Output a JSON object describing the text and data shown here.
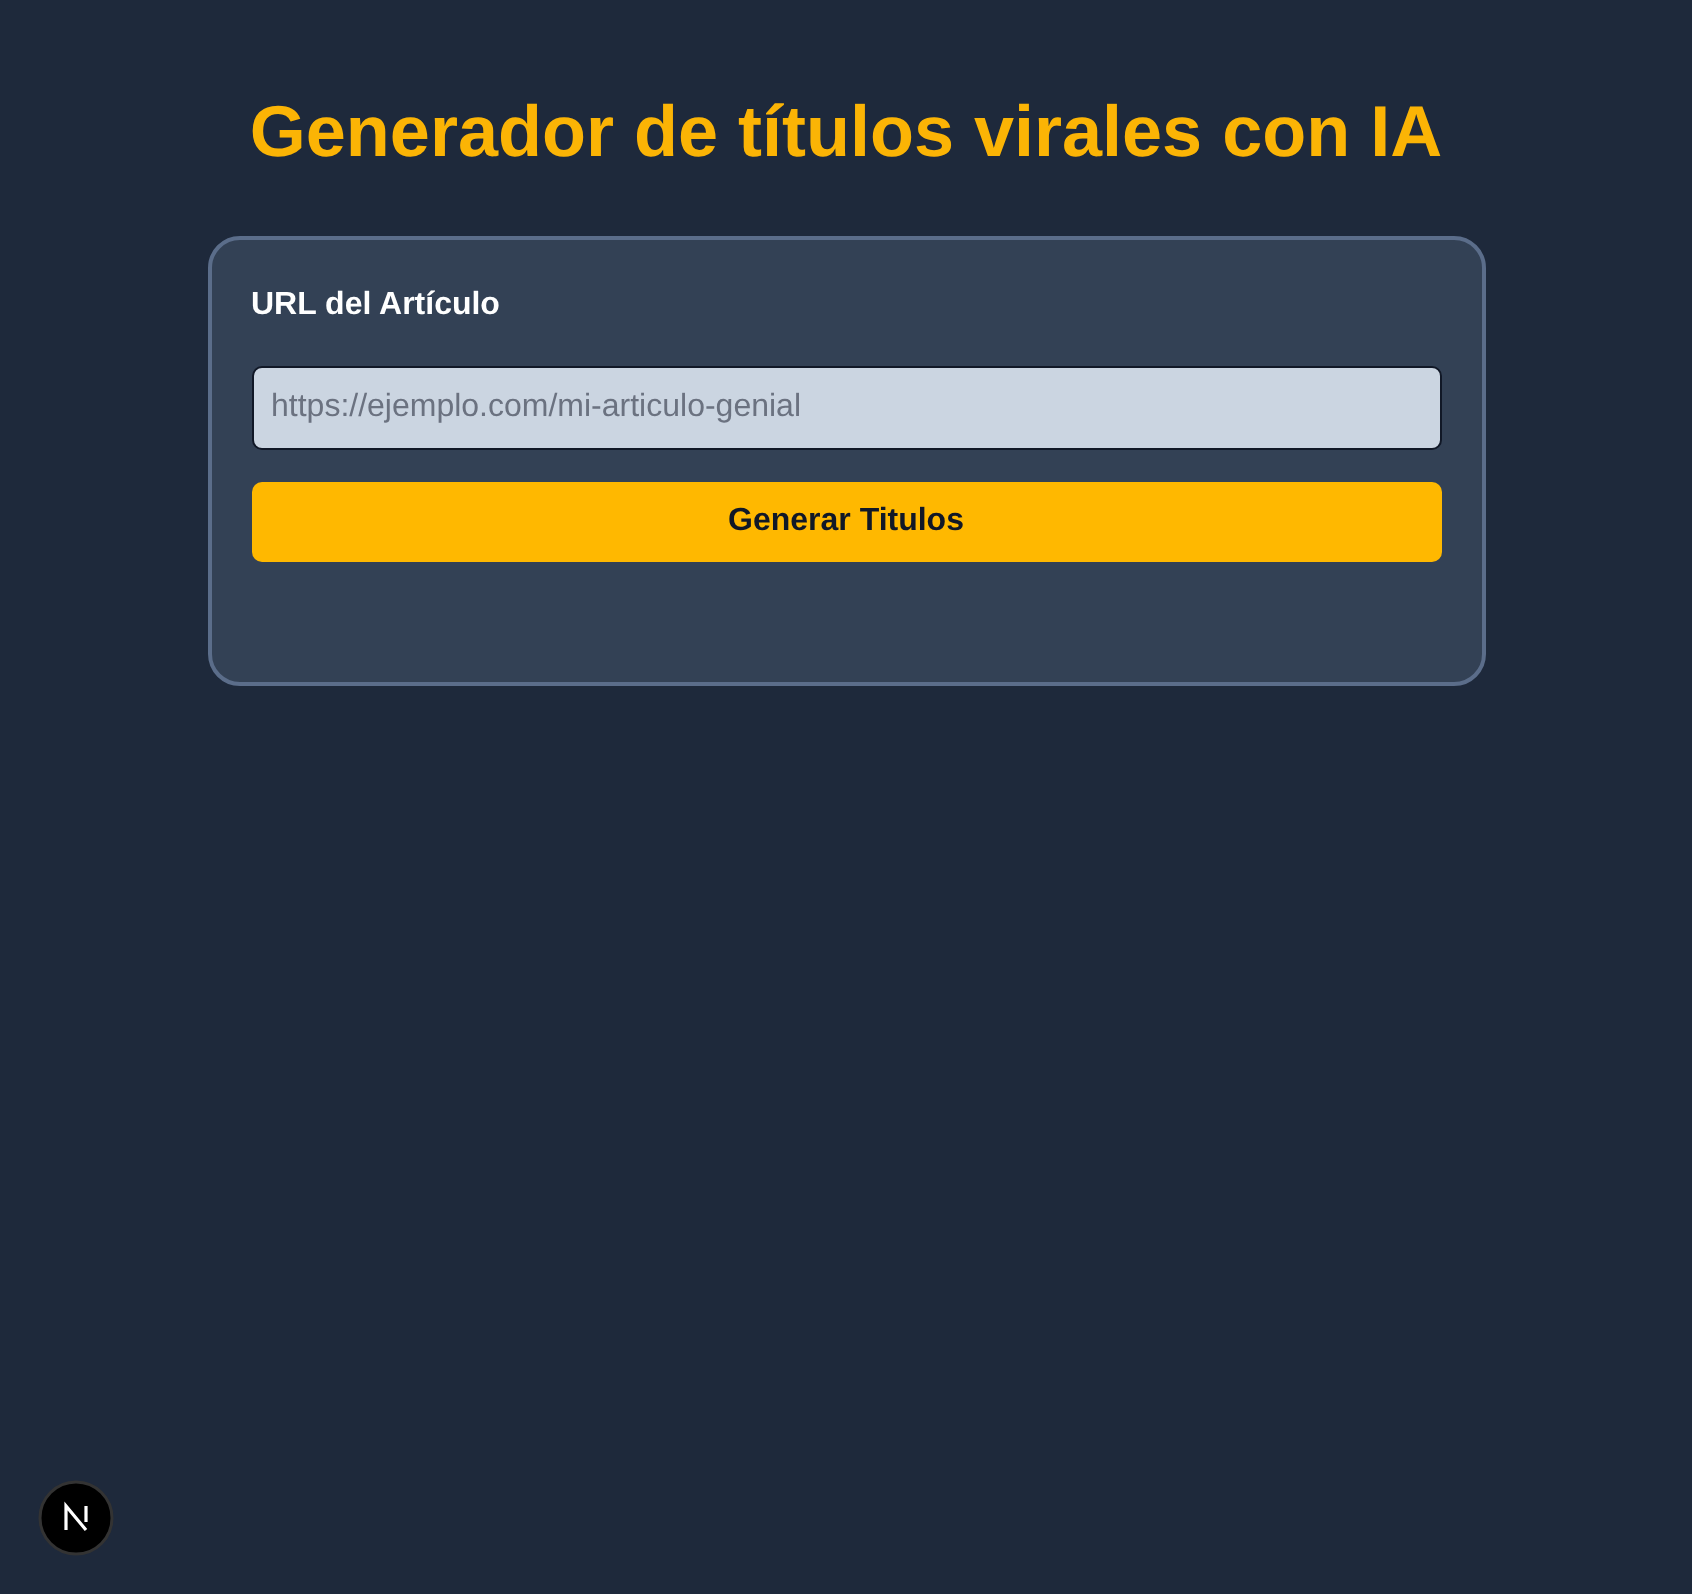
{
  "title": "Generador de títulos virales con IA",
  "form": {
    "label": "URL del Artículo",
    "url_field": {
      "placeholder": "https://ejemplo.com/mi-articulo-genial"
    },
    "submit_button": "Generar Titulos"
  }
}
